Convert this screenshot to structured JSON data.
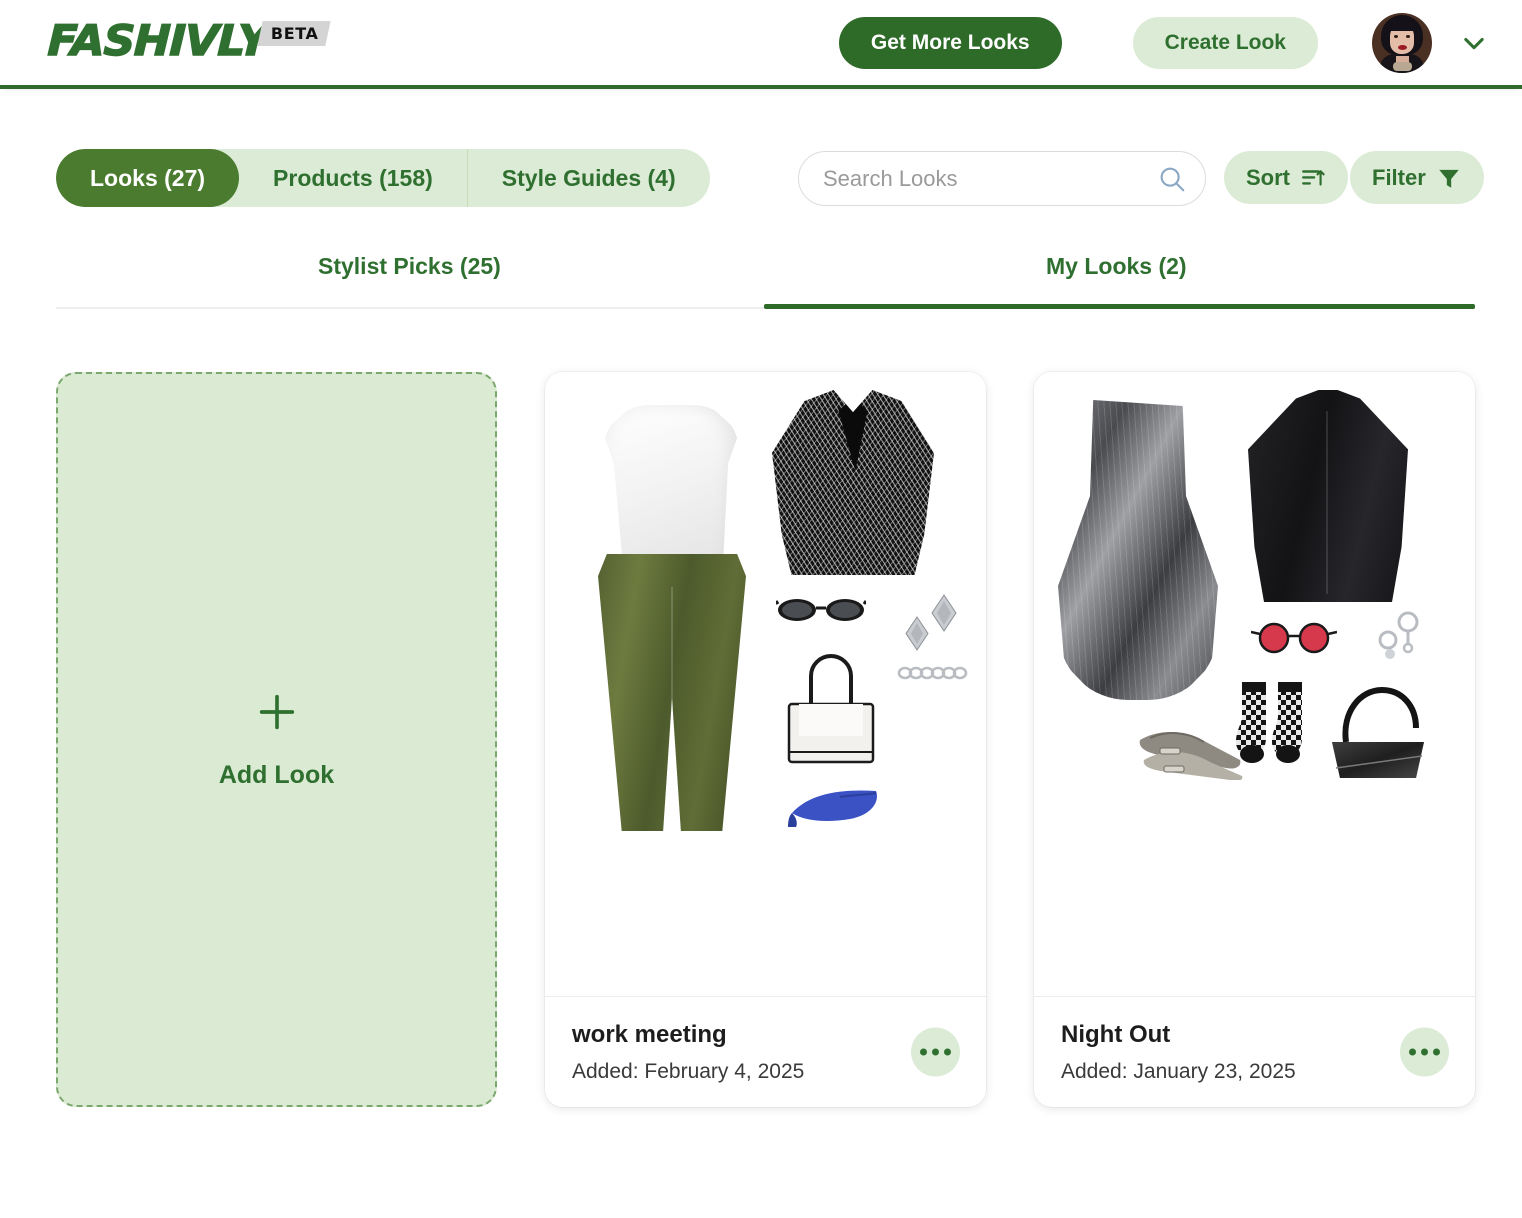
{
  "header": {
    "logo_text": "FASHIVLY",
    "logo_badge": "BETA",
    "get_more_looks_label": "Get More Looks",
    "create_look_label": "Create Look",
    "avatar_icon": "user-avatar",
    "chevron_icon": "chevron-down-icon",
    "accent_color": "#2f6b28",
    "soft_accent_color": "#dcebd5"
  },
  "toolbar": {
    "segments": [
      {
        "label": "Looks (27)",
        "active": true
      },
      {
        "label": "Products (158)",
        "active": false
      },
      {
        "label": "Style Guides (4)",
        "active": false
      }
    ],
    "search": {
      "placeholder": "Search Looks",
      "value": "",
      "icon": "search-icon"
    },
    "sort_label": "Sort",
    "sort_icon": "sort-icon",
    "filter_label": "Filter",
    "filter_icon": "funnel-icon"
  },
  "subtabs": [
    {
      "label": "Stylist Picks (25)",
      "active": false
    },
    {
      "label": "My Looks (2)",
      "active": true
    }
  ],
  "add_card": {
    "label": "Add Look",
    "icon": "plus-icon"
  },
  "looks": [
    {
      "title": "work meeting",
      "added": "Added: February 4, 2025",
      "menu_icon": "ellipsis-icon",
      "items": [
        "white-draped-top",
        "olive-satin-wide-leg-pants",
        "black-tweed-cropped-blazer",
        "black-oval-sunglasses",
        "silver-diamond-earrings",
        "white-leather-tote-bag",
        "silver-chain-bracelet",
        "blue-kitten-heel-mules"
      ]
    },
    {
      "title": "Night Out",
      "added": "Added: January 23, 2025",
      "menu_icon": "ellipsis-icon",
      "items": [
        "silver-metallic-strapless-bubble-dress",
        "black-collarless-blazer",
        "red-lens-round-sunglasses",
        "silver-drop-earrings",
        "black-checkered-socks",
        "metallic-pointed-mary-jane-flats",
        "black-shoulder-bag"
      ]
    }
  ]
}
